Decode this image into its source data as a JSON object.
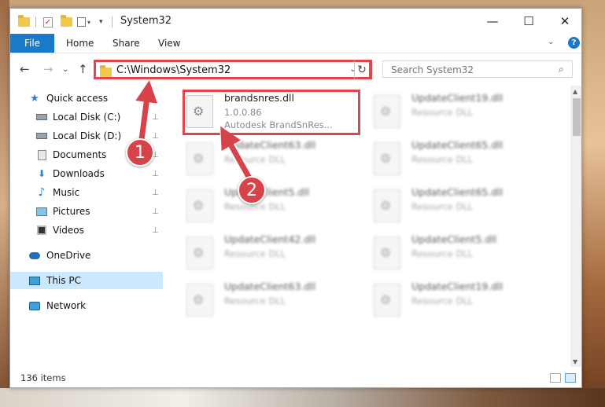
{
  "window": {
    "title": "System32",
    "minimize_glyph": "—",
    "maximize_glyph": "☐",
    "close_glyph": "✕"
  },
  "ribbon": {
    "file": "File",
    "home": "Home",
    "share": "Share",
    "view": "View",
    "expand_glyph": "⌄",
    "help_glyph": "?"
  },
  "nav_buttons": {
    "back": "←",
    "forward": "→",
    "dropdown": "⌄",
    "up": "↑"
  },
  "address": {
    "path": "C:\\Windows\\System32",
    "dropdown_glyph": "⌄",
    "refresh_glyph": "↻"
  },
  "search": {
    "placeholder": "Search System32",
    "icon_glyph": "⌕"
  },
  "sidebar": {
    "items": [
      {
        "label": "Quick access",
        "icon": "star-icon",
        "icon_glyph": "★",
        "pinned": false
      },
      {
        "label": "Local Disk (C:)",
        "icon": "disk-icon",
        "pinned": true
      },
      {
        "label": "Local Disk (D:)",
        "icon": "disk-icon",
        "pinned": true
      },
      {
        "label": "Documents",
        "icon": "documents-icon",
        "pinned": true
      },
      {
        "label": "Downloads",
        "icon": "downloads-icon",
        "icon_glyph": "⬇",
        "pinned": true
      },
      {
        "label": "Music",
        "icon": "music-icon",
        "icon_glyph": "♪",
        "pinned": true
      },
      {
        "label": "Pictures",
        "icon": "pictures-icon",
        "pinned": true
      },
      {
        "label": "Videos",
        "icon": "videos-icon",
        "pinned": true
      },
      {
        "label": "OneDrive",
        "icon": "onedrive-icon",
        "pinned": false
      },
      {
        "label": "This PC",
        "icon": "pc-icon",
        "pinned": false,
        "selected": true
      },
      {
        "label": "Network",
        "icon": "network-icon",
        "pinned": false
      }
    ],
    "pin_glyph": "📌"
  },
  "files": [
    {
      "name": "brandsnres.dll",
      "version": "1.0.0.86",
      "company": "Autodesk BrandSnRes...",
      "highlighted": true
    },
    {
      "name": "UpdateClient19.dll",
      "type": "Resource DLL"
    },
    {
      "name": "UpdateClient63.dll",
      "type": "Resource DLL"
    },
    {
      "name": "UpdateClient65.dll",
      "type": "Resource DLL"
    },
    {
      "name": "UpdateClient5.dll",
      "type": "Resource DLL"
    },
    {
      "name": "UpdateClient65.dll",
      "type": "Resource DLL"
    },
    {
      "name": "UpdateClient42.dll",
      "type": "Resource DLL"
    },
    {
      "name": "UpdateClient5.dll",
      "type": "Resource DLL"
    },
    {
      "name": "UpdateClient63.dll",
      "type": "Resource DLL"
    },
    {
      "name": "UpdateClient19.dll",
      "type": "Resource DLL"
    }
  ],
  "status": {
    "item_count": "136 items"
  },
  "annotations": {
    "step1": "1",
    "step2": "2",
    "color": "#d8434a"
  },
  "colors": {
    "accent": "#1979ca",
    "highlight_border": "#e0464c",
    "selected_bg": "#cce8ff"
  }
}
